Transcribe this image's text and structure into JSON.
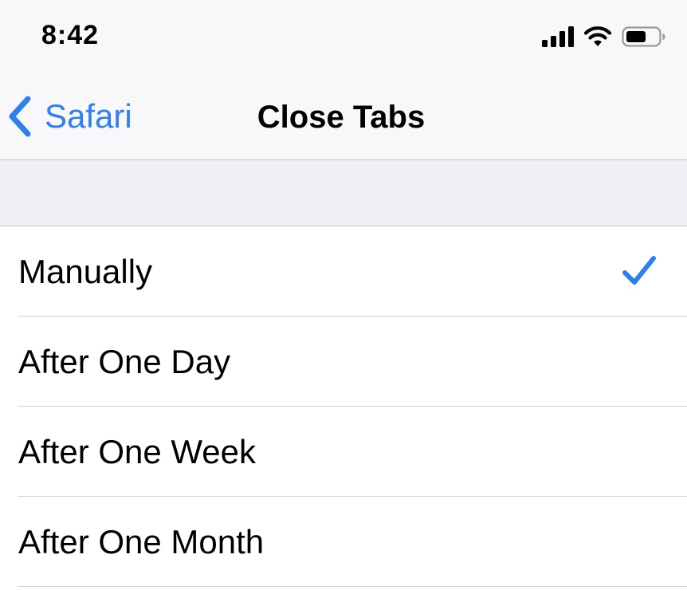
{
  "status_bar": {
    "time": "8:42",
    "icons": [
      "cellular-signal-icon",
      "wifi-icon",
      "battery-icon"
    ]
  },
  "nav": {
    "back_label": "Safari",
    "title": "Close Tabs"
  },
  "options": [
    {
      "label": "Manually",
      "selected": true
    },
    {
      "label": "After One Day",
      "selected": false
    },
    {
      "label": "After One Week",
      "selected": false
    },
    {
      "label": "After One Month",
      "selected": false
    }
  ],
  "colors": {
    "accent": "#2f80ed",
    "grouped_background": "#efeff4",
    "nav_background": "#f8f8fa",
    "separator": "#c6c6c8"
  }
}
